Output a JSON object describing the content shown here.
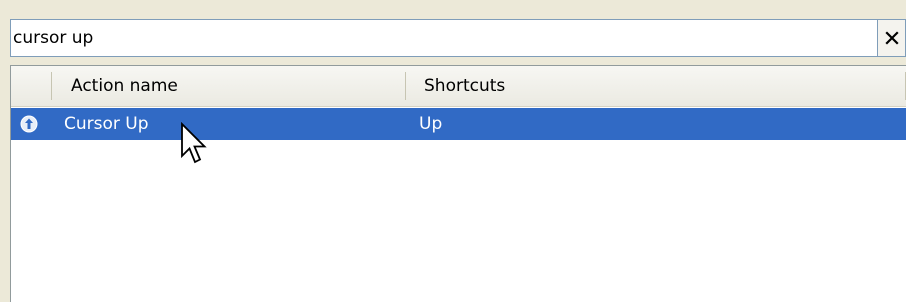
{
  "search": {
    "value": "cursor up",
    "clear_label": "×"
  },
  "table": {
    "columns": [
      "Action name",
      "Shortcuts"
    ],
    "rows": [
      {
        "icon": "action-icon",
        "name": "Cursor Up",
        "shortcut": "Up",
        "selected": true
      }
    ]
  },
  "colors": {
    "selection": "#316ac5",
    "panel_background": "#ece9d8"
  },
  "pointer": {
    "icon": "mouse-pointer-icon"
  }
}
